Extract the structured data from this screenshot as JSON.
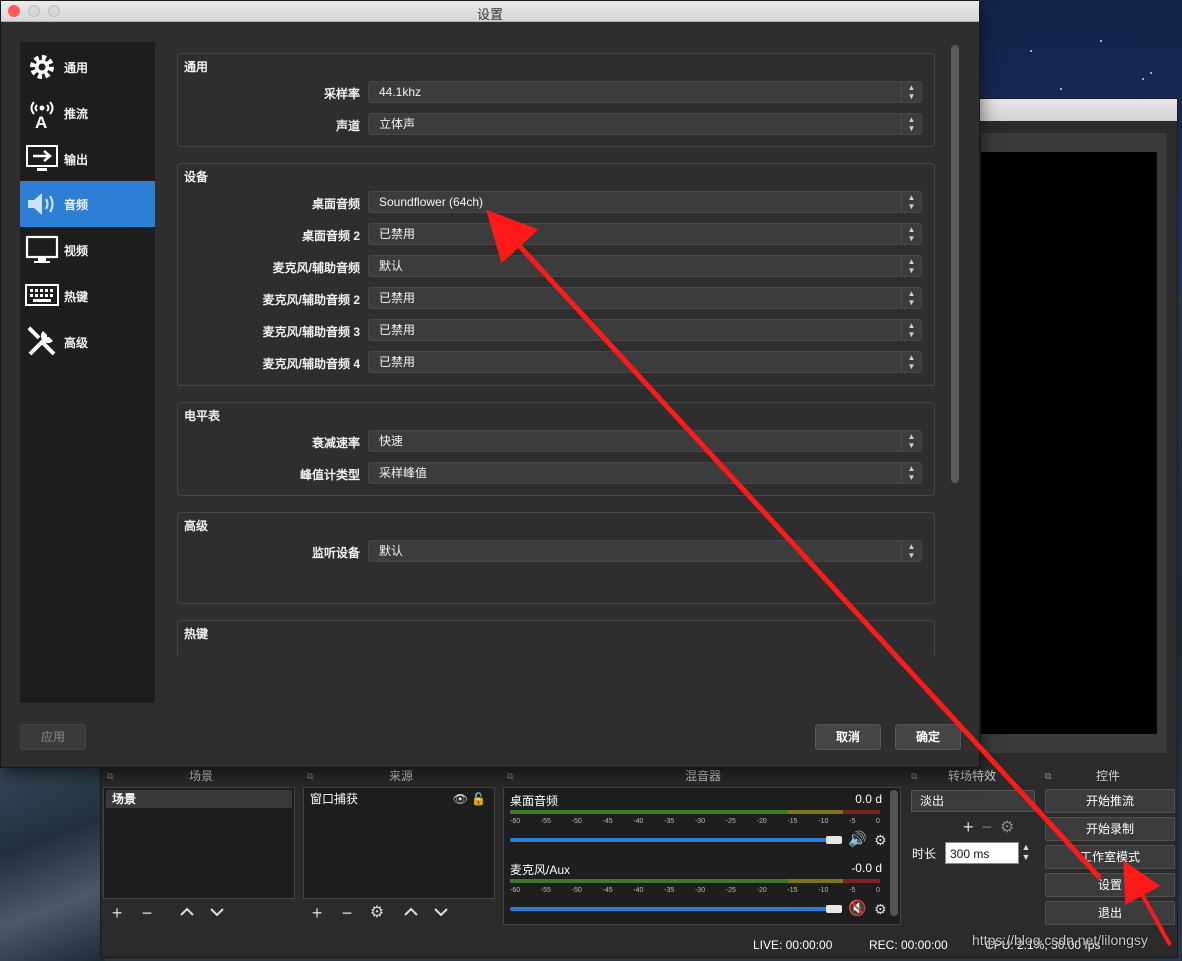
{
  "settings_dialog": {
    "title": "设置",
    "sidebar": [
      {
        "label": "通用",
        "icon": "gear-icon"
      },
      {
        "label": "推流",
        "icon": "broadcast-icon"
      },
      {
        "label": "输出",
        "icon": "output-icon"
      },
      {
        "label": "音频",
        "icon": "speaker-icon",
        "active": true
      },
      {
        "label": "视频",
        "icon": "monitor-icon"
      },
      {
        "label": "热键",
        "icon": "keyboard-icon"
      },
      {
        "label": "高级",
        "icon": "tools-icon"
      }
    ],
    "groups": {
      "general": {
        "title": "通用",
        "rows": [
          {
            "label": "采样率",
            "value": "44.1khz"
          },
          {
            "label": "声道",
            "value": "立体声"
          }
        ]
      },
      "devices": {
        "title": "设备",
        "rows": [
          {
            "label": "桌面音频",
            "value": "Soundflower (64ch)"
          },
          {
            "label": "桌面音频 2",
            "value": "已禁用"
          },
          {
            "label": "麦克风/辅助音频",
            "value": "默认"
          },
          {
            "label": "麦克风/辅助音频 2",
            "value": "已禁用"
          },
          {
            "label": "麦克风/辅助音频 3",
            "value": "已禁用"
          },
          {
            "label": "麦克风/辅助音频 4",
            "value": "已禁用"
          }
        ]
      },
      "meters": {
        "title": "电平表",
        "rows": [
          {
            "label": "衰减速率",
            "value": "快速"
          },
          {
            "label": "峰值计类型",
            "value": "采样峰值"
          }
        ]
      },
      "advanced": {
        "title": "高级",
        "rows": [
          {
            "label": "监听设备",
            "value": "默认"
          }
        ]
      },
      "hotkeys": {
        "title": "热键"
      }
    },
    "buttons": {
      "apply": "应用",
      "cancel": "取消",
      "ok": "确定"
    }
  },
  "obs_main": {
    "docks": {
      "scenes": {
        "title": "场景",
        "items": [
          "场景"
        ]
      },
      "sources": {
        "title": "来源",
        "items": [
          "窗口捕获"
        ]
      },
      "mixer": {
        "title": "混音器",
        "tracks": [
          {
            "name": "桌面音频",
            "db": "0.0 d",
            "volume": 0.93,
            "muted": false
          },
          {
            "name": "麦克风/Aux",
            "db": "-0.0 d",
            "volume": 0.93,
            "muted": true
          }
        ],
        "ticks": [
          "-60",
          "-55",
          "-50",
          "-45",
          "-40",
          "-35",
          "-30",
          "-25",
          "-20",
          "-15",
          "-10",
          "-5",
          "0"
        ]
      },
      "transitions": {
        "title": "转场特效",
        "selected": "淡出",
        "duration_label": "时长",
        "duration_value": "300 ms"
      },
      "controls": {
        "title": "控件",
        "buttons": [
          "开始推流",
          "开始录制",
          "工作室模式",
          "设置",
          "退出"
        ]
      }
    },
    "status": {
      "live": "LIVE: 00:00:00",
      "rec": "REC: 00:00:00",
      "cpu": "CPU: 2.1%, 30.00 fps"
    }
  },
  "watermark": "https://blog.csdn.net/lilongsy",
  "colors": {
    "accent": "#2d7fd6",
    "annotation_arrow": "#ff1a1a"
  }
}
